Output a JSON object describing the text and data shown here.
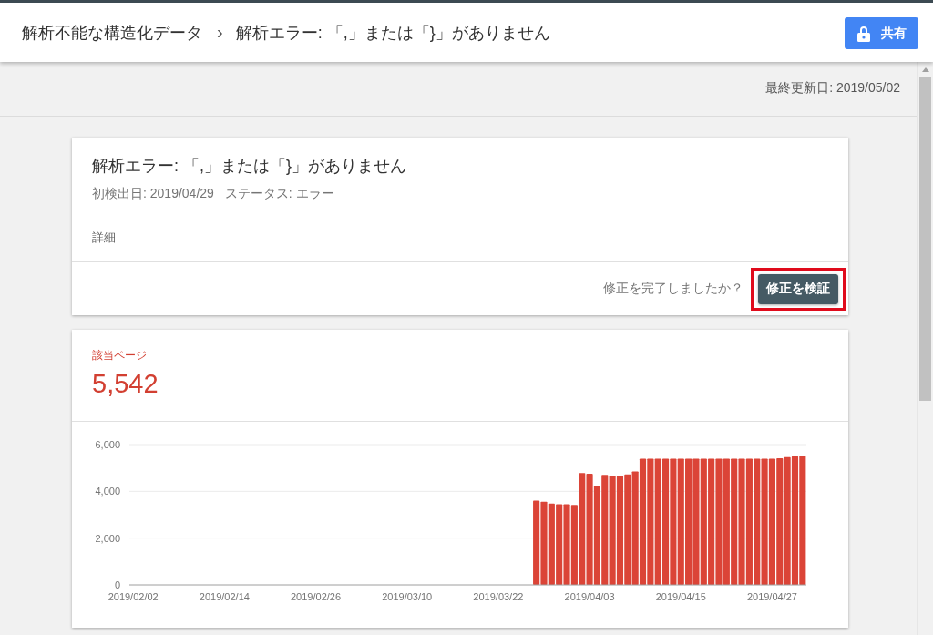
{
  "header": {
    "breadcrumb": [
      {
        "label": "解析不能な構造化データ"
      },
      {
        "label": "解析エラー: 「,」または「}」がありません"
      }
    ],
    "separator": "›",
    "share_button": "共有"
  },
  "last_updated": "最終更新日: 2019/05/02",
  "issue_card": {
    "title": "解析エラー: 「,」または「}」がありません",
    "first_detected": "初検出日: 2019/04/29",
    "status": "ステータス: エラー",
    "details_link": "詳細",
    "question": "修正を完了しましたか？",
    "verify_button": "修正を検証",
    "verify_highlighted": true
  },
  "pages_card": {
    "label": "該当ページ",
    "count": "5,542",
    "chart_data": {
      "type": "bar",
      "color": "#db4437",
      "categories": [
        "2019/02/02",
        null,
        null,
        null,
        null,
        null,
        null,
        null,
        null,
        null,
        null,
        null,
        "2019/02/14",
        null,
        null,
        null,
        null,
        null,
        null,
        null,
        null,
        null,
        null,
        null,
        "2019/02/26",
        null,
        null,
        null,
        null,
        null,
        null,
        null,
        null,
        null,
        null,
        null,
        "2019/03/10",
        null,
        null,
        null,
        null,
        null,
        null,
        null,
        null,
        null,
        null,
        null,
        "2019/03/22",
        null,
        null,
        null,
        null,
        null,
        null,
        null,
        null,
        null,
        null,
        null,
        "2019/04/03",
        null,
        null,
        null,
        null,
        null,
        null,
        null,
        null,
        null,
        null,
        null,
        "2019/04/15",
        null,
        null,
        null,
        null,
        null,
        null,
        null,
        null,
        null,
        null,
        null,
        "2019/04/27",
        null,
        null,
        null,
        null
      ],
      "values": [
        null,
        null,
        null,
        null,
        null,
        null,
        null,
        null,
        null,
        null,
        null,
        null,
        null,
        null,
        null,
        null,
        null,
        null,
        null,
        null,
        null,
        null,
        null,
        null,
        null,
        null,
        null,
        null,
        null,
        null,
        null,
        null,
        null,
        null,
        null,
        null,
        null,
        null,
        null,
        null,
        null,
        null,
        null,
        null,
        null,
        null,
        null,
        null,
        null,
        null,
        null,
        null,
        null,
        3600,
        3560,
        3480,
        3450,
        3450,
        3420,
        4780,
        4750,
        4250,
        4700,
        4680,
        4680,
        4720,
        4850,
        5400,
        5400,
        5400,
        5400,
        5400,
        5400,
        5400,
        5400,
        5400,
        5400,
        5400,
        5400,
        5400,
        5400,
        5400,
        5400,
        5400,
        5400,
        5420,
        5460,
        5500,
        5530
      ],
      "ylim": [
        0,
        6000
      ],
      "yticks": [
        {
          "value": 0,
          "label": "0"
        },
        {
          "value": 2000,
          "label": "2,000"
        },
        {
          "value": 4000,
          "label": "4,000"
        },
        {
          "value": 6000,
          "label": "6,000"
        }
      ]
    }
  }
}
